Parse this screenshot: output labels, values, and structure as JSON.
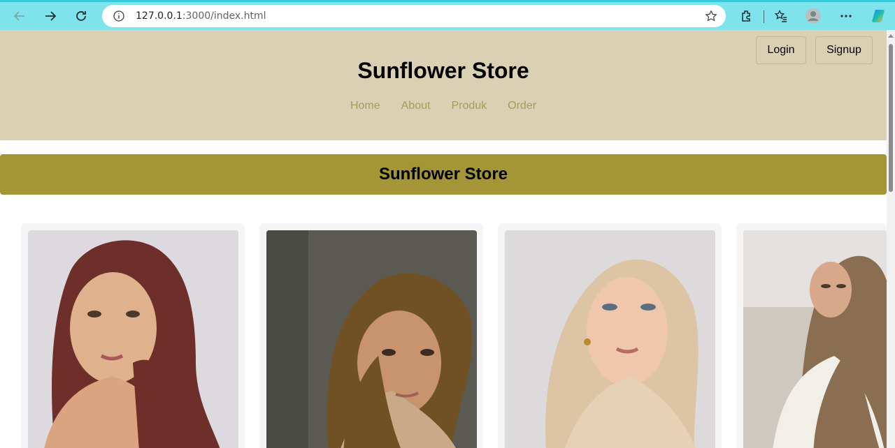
{
  "browser": {
    "url_host": "127.0.0.1",
    "url_rest": ":3000/index.html",
    "icons": [
      "back-icon",
      "forward-icon",
      "reload-icon",
      "info-icon",
      "star-icon",
      "extensions-icon",
      "favorites-icon",
      "profile-icon",
      "more-icon",
      "copilot-icon"
    ]
  },
  "header": {
    "title": "Sunflower Store",
    "nav": [
      "Home",
      "About",
      "Produk",
      "Order"
    ],
    "login_label": "Login",
    "signup_label": "Signup"
  },
  "banner": {
    "title": "Sunflower Store"
  },
  "products": [
    {
      "image": "model wearing maroon hijab",
      "scarf_color": "#6e2f2a",
      "bg_color": "#dcd9df"
    },
    {
      "image": "model wearing brown jersey hijab",
      "scarf_color": "#6f5123",
      "bg_color": "#5a5a52"
    },
    {
      "image": "model wearing champagne satin hijab",
      "scarf_color": "#dcc4a4",
      "bg_color": "#dddadc"
    },
    {
      "image": "model wearing mocha hijab sitting",
      "scarf_color": "#8a6e51",
      "bg_color": "#e4e1de"
    }
  ],
  "colors": {
    "header_bg": "#dad0b3",
    "nav_link": "#a69c57",
    "banner_bg": "#a49636"
  }
}
